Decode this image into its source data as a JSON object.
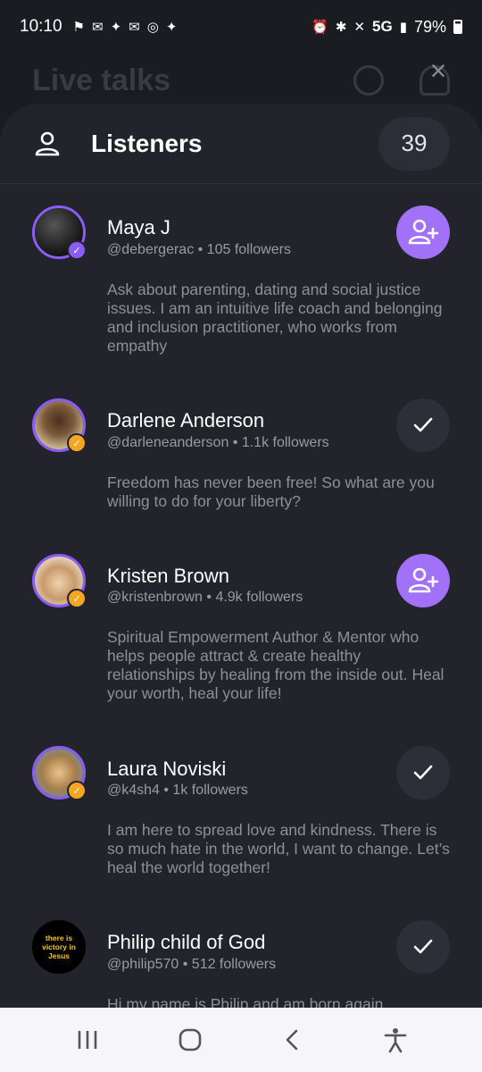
{
  "status_bar": {
    "time": "10:10",
    "network": "5G",
    "battery": "79%",
    "battery_level": 0.79
  },
  "background": {
    "title": "Live talks"
  },
  "sheet": {
    "title": "Listeners",
    "count": "39"
  },
  "listeners": [
    {
      "name": "Maya J",
      "handle": "@debergerac • 105 followers",
      "bio": "Ask about parenting, dating and social justice issues. I am an intuitive life coach and belonging and inclusion practitioner, who works from empathy",
      "status": "follow",
      "badge": "purple",
      "avatar_color": "#2a2a2a"
    },
    {
      "name": "Darlene Anderson",
      "handle": "@darleneanderson • 1.1k followers",
      "bio": "Freedom has never been free! So what are you willing to do for your liberty?",
      "status": "following",
      "badge": "gold",
      "avatar_color": "#c7a37a"
    },
    {
      "name": "Kristen Brown",
      "handle": "@kristenbrown • 4.9k followers",
      "bio": "Spiritual Empowerment Author & Mentor who helps people attract & create healthy relationships by healing from the inside out. Heal your worth, heal your life!",
      "status": "follow",
      "badge": "gold",
      "avatar_color": "#d9b48a"
    },
    {
      "name": "Laura Noviski",
      "handle": "@k4sh4 • 1k followers",
      "bio": "I am here to spread love and kindness. There is so much hate in the world, I want to change. Let’s heal the world together!",
      "status": "following",
      "badge": "gold",
      "avatar_color": "#c9a06b"
    },
    {
      "name": "Philip child of God",
      "handle": "@philip570 • 512 followers",
      "bio": "Hi my name is Philip and am born again",
      "status": "following",
      "badge": "none",
      "avatar_color": "#000000",
      "avatar_text": "there is victory in Jesus"
    }
  ],
  "colors": {
    "accent": "#a171f7",
    "verified_purple": "#8b5cf6",
    "verified_gold": "#f5a623"
  }
}
